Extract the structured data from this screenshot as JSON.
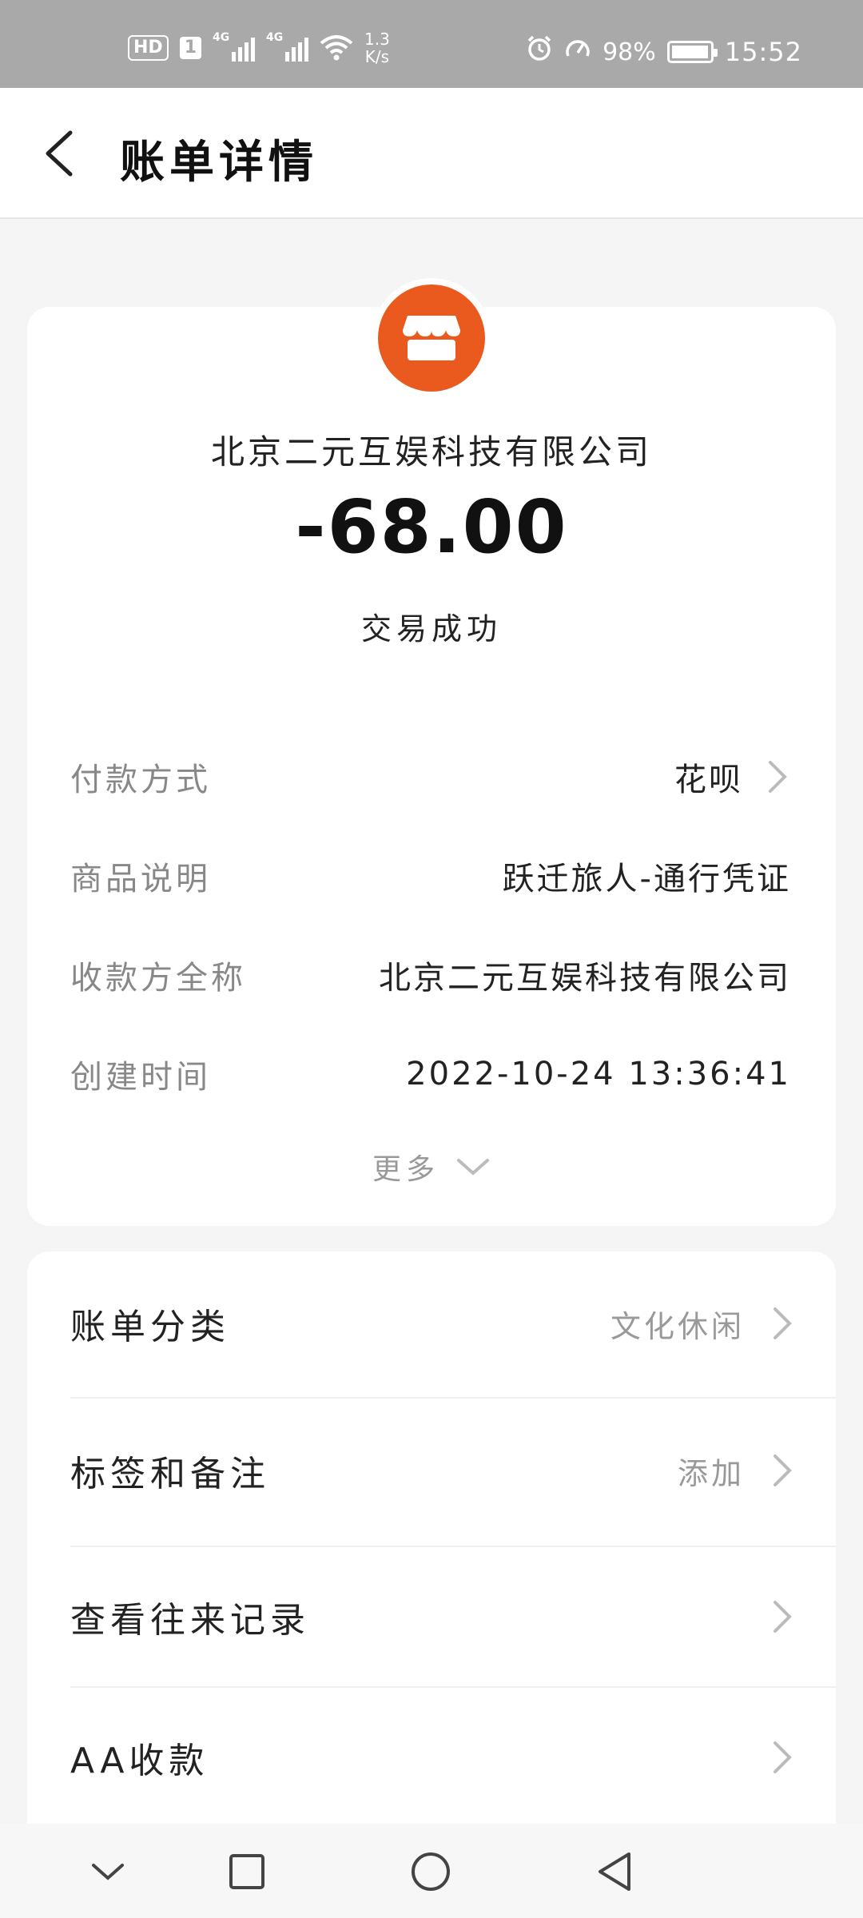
{
  "status_bar": {
    "hd_label": "HD",
    "sim_label": "1",
    "network_1": "4G",
    "network_2": "4G",
    "speed_value": "1.3",
    "speed_unit": "K/s",
    "battery_percent": "98%",
    "battery_level": 0.98,
    "time": "15:52"
  },
  "header": {
    "title": "账单详情"
  },
  "transaction": {
    "merchant_name": "北京二元互娱科技有限公司",
    "amount": "-68.00",
    "status": "交易成功",
    "logo_icon": "store-icon",
    "logo_color": "#ea5a1e"
  },
  "details": [
    {
      "label": "付款方式",
      "value": "花呗"
    },
    {
      "label": "商品说明",
      "value": "跃迁旅人-通行凭证"
    },
    {
      "label": "收款方全称",
      "value": "北京二元互娱科技有限公司"
    },
    {
      "label": "创建时间",
      "value": "2022-10-24 13:36:41"
    }
  ],
  "more_label": "更多",
  "actions": [
    {
      "label": "账单分类",
      "value": "文化休闲"
    },
    {
      "label": "标签和备注",
      "value": "添加"
    },
    {
      "label": "查看往来记录",
      "value": ""
    },
    {
      "label": "AA收款",
      "value": ""
    }
  ]
}
